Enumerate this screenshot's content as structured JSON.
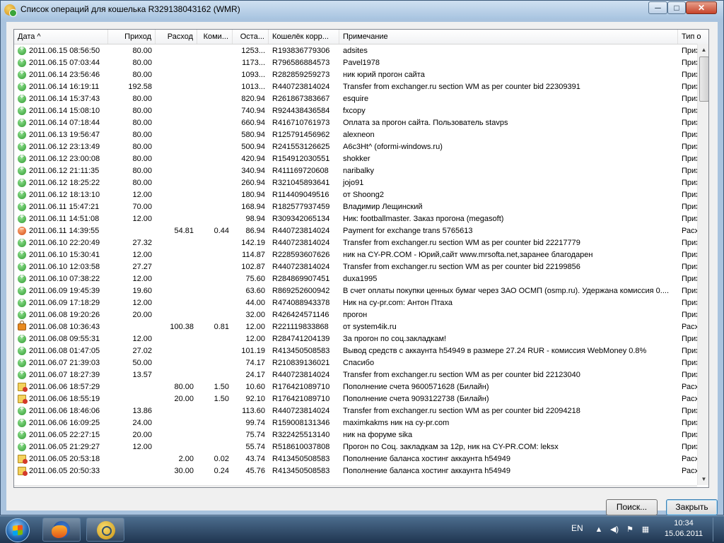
{
  "window": {
    "title": "Список операций для кошелька R329138043162 (WMR)",
    "controls": {
      "minimize": "─",
      "maximize": "□",
      "close": "✕"
    }
  },
  "columns": [
    {
      "key": "date",
      "label": "Дата  ^"
    },
    {
      "key": "income",
      "label": "Приход"
    },
    {
      "key": "expense",
      "label": "Расход"
    },
    {
      "key": "fee",
      "label": "Коми..."
    },
    {
      "key": "balance",
      "label": "Оста..."
    },
    {
      "key": "wallet",
      "label": "Кошелёк корр..."
    },
    {
      "key": "note",
      "label": "Примечание"
    },
    {
      "key": "type",
      "label": "Тип о"
    }
  ],
  "rows": [
    {
      "icon": "in",
      "date": "2011.06.15 08:56:50",
      "income": "80.00",
      "expense": "",
      "fee": "",
      "balance": "1253...",
      "wallet": "R193836779306",
      "note": "adsites",
      "type": "Прих"
    },
    {
      "icon": "in",
      "date": "2011.06.15 07:03:44",
      "income": "80.00",
      "expense": "",
      "fee": "",
      "balance": "1173...",
      "wallet": "R796586884573",
      "note": "Pavel1978",
      "type": "Прих"
    },
    {
      "icon": "in",
      "date": "2011.06.14 23:56:46",
      "income": "80.00",
      "expense": "",
      "fee": "",
      "balance": "1093...",
      "wallet": "R282859259273",
      "note": "ник юрий прогон сайта",
      "type": "Прих"
    },
    {
      "icon": "in",
      "date": "2011.06.14 16:19:11",
      "income": "192.58",
      "expense": "",
      "fee": "",
      "balance": "1013...",
      "wallet": "R440723814024",
      "note": "Transfer from exchanger.ru section WM as per counter bid 22309391",
      "type": "Прих"
    },
    {
      "icon": "in",
      "date": "2011.06.14 15:37:43",
      "income": "80.00",
      "expense": "",
      "fee": "",
      "balance": "820.94",
      "wallet": "R261867383667",
      "note": "esquire",
      "type": "Прих"
    },
    {
      "icon": "in",
      "date": "2011.06.14 15:08:10",
      "income": "80.00",
      "expense": "",
      "fee": "",
      "balance": "740.94",
      "wallet": "R924438436584",
      "note": "fxcopy",
      "type": "Прих"
    },
    {
      "icon": "in",
      "date": "2011.06.14 07:18:44",
      "income": "80.00",
      "expense": "",
      "fee": "",
      "balance": "660.94",
      "wallet": "R416710761973",
      "note": "Оплата за прогон сайта. Пользователь stavps",
      "type": "Прих"
    },
    {
      "icon": "in",
      "date": "2011.06.13 19:56:47",
      "income": "80.00",
      "expense": "",
      "fee": "",
      "balance": "580.94",
      "wallet": "R125791456962",
      "note": "alexneon",
      "type": "Прих"
    },
    {
      "icon": "in",
      "date": "2011.06.12 23:13:49",
      "income": "80.00",
      "expense": "",
      "fee": "",
      "balance": "500.94",
      "wallet": "R241553126625",
      "note": "A6c3Ht^ (oformi-windows.ru)",
      "type": "Прих"
    },
    {
      "icon": "in",
      "date": "2011.06.12 23:00:08",
      "income": "80.00",
      "expense": "",
      "fee": "",
      "balance": "420.94",
      "wallet": "R154912030551",
      "note": "shokker",
      "type": "Прих"
    },
    {
      "icon": "in",
      "date": "2011.06.12 21:11:35",
      "income": "80.00",
      "expense": "",
      "fee": "",
      "balance": "340.94",
      "wallet": "R411169720608",
      "note": "naribalky",
      "type": "Прих"
    },
    {
      "icon": "in",
      "date": "2011.06.12 18:25:22",
      "income": "80.00",
      "expense": "",
      "fee": "",
      "balance": "260.94",
      "wallet": "R321045893641",
      "note": "jojo91",
      "type": "Прих"
    },
    {
      "icon": "in",
      "date": "2011.06.12 18:13:10",
      "income": "12.00",
      "expense": "",
      "fee": "",
      "balance": "180.94",
      "wallet": "R114409049516",
      "note": "от Shoong2",
      "type": "Прих"
    },
    {
      "icon": "in",
      "date": "2011.06.11 15:47:21",
      "income": "70.00",
      "expense": "",
      "fee": "",
      "balance": "168.94",
      "wallet": "R182577937459",
      "note": "Владимир Лещинский",
      "type": "Прих"
    },
    {
      "icon": "in",
      "date": "2011.06.11 14:51:08",
      "income": "12.00",
      "expense": "",
      "fee": "",
      "balance": "98.94",
      "wallet": "R309342065134",
      "note": "Ник: footballmaster. Заказ прогона (megasoft)",
      "type": "Прих"
    },
    {
      "icon": "out",
      "date": "2011.06.11 14:39:55",
      "income": "",
      "expense": "54.81",
      "fee": "0.44",
      "balance": "86.94",
      "wallet": "R440723814024",
      "note": "Payment for exchange trans 5765613",
      "type": "Расх"
    },
    {
      "icon": "in",
      "date": "2011.06.10 22:20:49",
      "income": "27.32",
      "expense": "",
      "fee": "",
      "balance": "142.19",
      "wallet": "R440723814024",
      "note": "Transfer from exchanger.ru section WM as per counter bid 22217779",
      "type": "Прих"
    },
    {
      "icon": "in",
      "date": "2011.06.10 15:30:41",
      "income": "12.00",
      "expense": "",
      "fee": "",
      "balance": "114.87",
      "wallet": "R228593607626",
      "note": "ник на CY-PR.COM - Юрий,сайт www.mrsofta.net,заранее благодарен",
      "type": "Прих"
    },
    {
      "icon": "in",
      "date": "2011.06.10 12:03:58",
      "income": "27.27",
      "expense": "",
      "fee": "",
      "balance": "102.87",
      "wallet": "R440723814024",
      "note": "Transfer from exchanger.ru section WM as per counter bid 22199856",
      "type": "Прих"
    },
    {
      "icon": "in",
      "date": "2011.06.10 07:38:22",
      "income": "12.00",
      "expense": "",
      "fee": "",
      "balance": "75.60",
      "wallet": "R284869907451",
      "note": "duxa1995",
      "type": "Прих"
    },
    {
      "icon": "in",
      "date": "2011.06.09 19:45:39",
      "income": "19.60",
      "expense": "",
      "fee": "",
      "balance": "63.60",
      "wallet": "R869252600942",
      "note": "В счет оплаты покупки ценных бумаг через ЗАО ОСМП (osmp.ru). Удержана комиссия 0....",
      "type": "Прих"
    },
    {
      "icon": "in",
      "date": "2011.06.09 17:18:29",
      "income": "12.00",
      "expense": "",
      "fee": "",
      "balance": "44.00",
      "wallet": "R474088943378",
      "note": "Ник на cy-pr.com: Антон Птаха",
      "type": "Прих"
    },
    {
      "icon": "in",
      "date": "2011.06.08 19:20:26",
      "income": "20.00",
      "expense": "",
      "fee": "",
      "balance": "32.00",
      "wallet": "R426424571146",
      "note": "прогон",
      "type": "Прих"
    },
    {
      "icon": "lock",
      "date": "2011.06.08 10:36:43",
      "income": "",
      "expense": "100.38",
      "fee": "0.81",
      "balance": "12.00",
      "wallet": "R221119833868",
      "note": "от system4ik.ru",
      "type": "Расх"
    },
    {
      "icon": "in",
      "date": "2011.06.08 09:55:31",
      "income": "12.00",
      "expense": "",
      "fee": "",
      "balance": "12.00",
      "wallet": "R284741204139",
      "note": "За прогон по соц.закладкам!",
      "type": "Прих"
    },
    {
      "icon": "in",
      "date": "2011.06.08 01:47:05",
      "income": "27.02",
      "expense": "",
      "fee": "",
      "balance": "101.19",
      "wallet": "R413450508583",
      "note": "Вывод средств с аккаунта h54949 в размере 27.24 RUR - комиссия WebMoney 0.8%",
      "type": "Прих"
    },
    {
      "icon": "in",
      "date": "2011.06.07 21:39:03",
      "income": "50.00",
      "expense": "",
      "fee": "",
      "balance": "74.17",
      "wallet": "R210839136021",
      "note": "Спасибо",
      "type": "Прих"
    },
    {
      "icon": "in",
      "date": "2011.06.07 18:27:39",
      "income": "13.57",
      "expense": "",
      "fee": "",
      "balance": "24.17",
      "wallet": "R440723814024",
      "note": "Transfer from exchanger.ru section WM as per counter bid 22123040",
      "type": "Прих"
    },
    {
      "icon": "bill",
      "date": "2011.06.06 18:57:29",
      "income": "",
      "expense": "80.00",
      "fee": "1.50",
      "balance": "10.60",
      "wallet": "R176421089710",
      "note": "Пополнение счета 9600571628 (Билайн)",
      "type": "Расх"
    },
    {
      "icon": "bill",
      "date": "2011.06.06 18:55:19",
      "income": "",
      "expense": "20.00",
      "fee": "1.50",
      "balance": "92.10",
      "wallet": "R176421089710",
      "note": "Пополнение счета 9093122738 (Билайн)",
      "type": "Расх"
    },
    {
      "icon": "in",
      "date": "2011.06.06 18:46:06",
      "income": "13.86",
      "expense": "",
      "fee": "",
      "balance": "113.60",
      "wallet": "R440723814024",
      "note": "Transfer from exchanger.ru section WM as per counter bid 22094218",
      "type": "Прих"
    },
    {
      "icon": "in",
      "date": "2011.06.06 16:09:25",
      "income": "24.00",
      "expense": "",
      "fee": "",
      "balance": "99.74",
      "wallet": "R159008131346",
      "note": "maximkakms ник на cy-pr.com",
      "type": "Прих"
    },
    {
      "icon": "in",
      "date": "2011.06.05 22:27:15",
      "income": "20.00",
      "expense": "",
      "fee": "",
      "balance": "75.74",
      "wallet": "R322425513140",
      "note": "ник на форуме  sika",
      "type": "Прих"
    },
    {
      "icon": "in",
      "date": "2011.06.05 21:29:27",
      "income": "12.00",
      "expense": "",
      "fee": "",
      "balance": "55.74",
      "wallet": "R518610037808",
      "note": "Прогон по Соц. закладкам за 12р,  ник на CY-PR.COM:  leksx",
      "type": "Прих"
    },
    {
      "icon": "bill",
      "date": "2011.06.05 20:53:18",
      "income": "",
      "expense": "2.00",
      "fee": "0.02",
      "balance": "43.74",
      "wallet": "R413450508583",
      "note": "Пополнение баланса хостинг аккаунта h54949",
      "type": "Расх"
    },
    {
      "icon": "bill",
      "date": "2011.06.05 20:50:33",
      "income": "",
      "expense": "30.00",
      "fee": "0.24",
      "balance": "45.76",
      "wallet": "R413450508583",
      "note": "Пополнение баланса хостинг аккаунта h54949",
      "type": "Расх"
    }
  ],
  "scrollbars": {
    "vertical_arrow_up": "▲",
    "vertical_arrow_down": "▼",
    "horizontal_arrow_left": "◄",
    "horizontal_arrow_right": "►",
    "horizontal_grip": "|||"
  },
  "buttons": {
    "search": "Поиск...",
    "close": "Закрыть"
  },
  "taskbar": {
    "language": "EN",
    "tray": {
      "show_hidden": "▲",
      "volume": "◀)",
      "flag": "⚑",
      "network": "▦",
      "show_desktop": ""
    },
    "clock": {
      "time": "10:34",
      "date": "15.06.2011"
    }
  }
}
